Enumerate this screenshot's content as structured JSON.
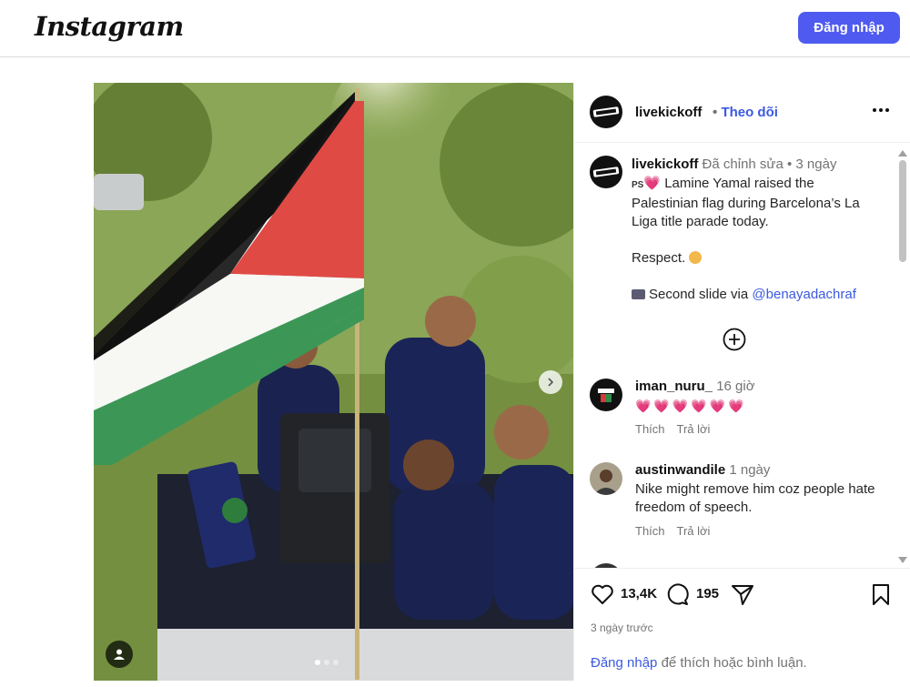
{
  "header": {
    "logo_text": "Instagram",
    "login_button": "Đăng nhập"
  },
  "post": {
    "username": "livekickoff",
    "separator": "•",
    "follow_label": "Theo dõi",
    "caption": {
      "username": "livekickoff",
      "edited_label": "Đã chỉnh sửa",
      "separator": "•",
      "time": "3 ngày",
      "ps_label": "PS",
      "heart_emoji": "💗",
      "line1": "Lamine Yamal raised the Palestinian flag during Barcelona’s La Liga title parade today.",
      "line2": "Respect.",
      "line3_prefix": "Second slide via",
      "line3_mention": "@benayadachraf"
    },
    "comments": [
      {
        "username": "iman_nuru_",
        "time": "16 giờ",
        "text": "💗💗💗💗💗💗",
        "like_label": "Thích",
        "reply_label": "Trả lời"
      },
      {
        "username": "austinwandile",
        "time": "1 ngày",
        "text": "Nike might remove him coz people hate freedom of speech.",
        "like_label": "Thích",
        "reply_label": "Trả lời"
      }
    ],
    "likes_count": "13,4K",
    "comments_count": "195",
    "timestamp": "3 ngày trước",
    "login_prompt": {
      "link": "Đăng nhập",
      "text": "để thích hoặc bình luận."
    }
  },
  "carousel": {
    "slides": 3,
    "active_slide": 1
  },
  "icons": {
    "more": "more-horizontal-icon",
    "like": "heart-icon",
    "comment": "comment-icon",
    "share": "share-icon",
    "save": "bookmark-icon",
    "add_comment": "plus-circle-icon",
    "user_tag": "user-tag-icon",
    "next": "chevron-right-icon"
  },
  "colors": {
    "accent": "#4f5bf0",
    "link": "#3b59e0",
    "heart": "#e8335a",
    "muted": "#737373"
  }
}
